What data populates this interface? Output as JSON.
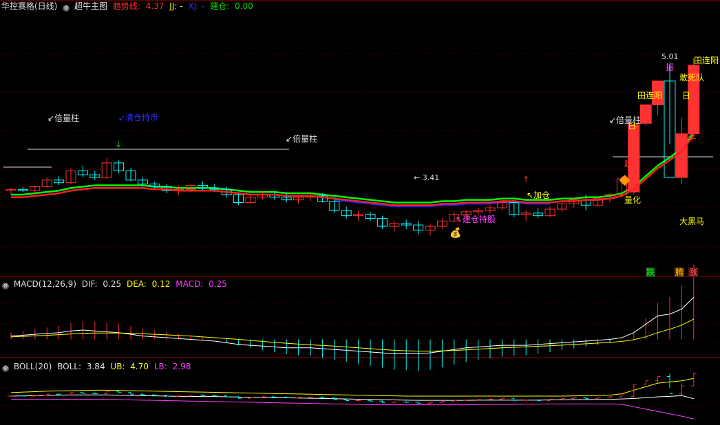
{
  "header_main": {
    "title": "华控赛格(日线)",
    "indicator": "超牛主图",
    "trend_label": "趋势线:",
    "trend_value": "4.37",
    "jj_label": "JJ: -",
    "xj_label": "XJ: -",
    "jc_label": "建仓:",
    "jc_value": "0.00"
  },
  "header_macd": {
    "name": "MACD(12,26,9)",
    "dif_label": "DIF:",
    "dif_value": "0.25",
    "dea_label": "DEA:",
    "dea_value": "0.12",
    "macd_label": "MACD:",
    "macd_value": "0.25"
  },
  "header_boll": {
    "name": "BOLL(20)",
    "boll_label": "BOLL:",
    "boll_value": "3.84",
    "ub_label": "UB:",
    "ub_value": "4.70",
    "lb_label": "LB:",
    "lb_value": "2.98"
  },
  "annotations": {
    "beiliangzhu_1": "↙倍量柱",
    "qingcang": "↙清仓持币",
    "beiliangzhu_2": "↙倍量柱",
    "low_price": "← 3.41",
    "jiancang": "↖建仓持股",
    "jiacang": "↖加仓",
    "beiliangzhu_3": "↙倍量柱",
    "chaoniu_1": "超牛",
    "chaoniu_2": "超牛",
    "lianglua": "量化",
    "dahei": "大黑马",
    "tianlianyang_1": "田连阳",
    "tianlianyang_2": "田连阳",
    "gansidui": "敢死队",
    "zhen": "振",
    "high_price": "5.01",
    "ri_1": "日",
    "ri_2": "日",
    "die": "跌",
    "zhang": "涨",
    "teng": "腾"
  },
  "colors": {
    "bg": "#000000",
    "grid": "#8b0000",
    "up": "#ff3232",
    "down": "#00ffff",
    "trend": "#ff2020",
    "green_line": "#00ff00",
    "blue_line": "#2020ff",
    "macd_dif": "#ffffff",
    "macd_dea": "#ffff00",
    "boll_mid": "#ffffff",
    "boll_ub": "#ffff00",
    "boll_lb": "#ff40ff"
  },
  "chart_data": {
    "type": "candlestick",
    "candles": [
      [
        3.95,
        3.97,
        3.92,
        3.96
      ],
      [
        3.96,
        3.98,
        3.94,
        3.95
      ],
      [
        3.95,
        3.99,
        3.93,
        3.98
      ],
      [
        3.98,
        4.05,
        3.97,
        4.03
      ],
      [
        4.03,
        4.06,
        3.99,
        4.01
      ],
      [
        4.01,
        4.12,
        4.0,
        4.1
      ],
      [
        4.1,
        4.14,
        4.05,
        4.07
      ],
      [
        4.07,
        4.1,
        4.03,
        4.05
      ],
      [
        4.05,
        4.2,
        4.04,
        4.16
      ],
      [
        4.16,
        4.18,
        4.08,
        4.1
      ],
      [
        4.1,
        4.12,
        4.02,
        4.03
      ],
      [
        4.03,
        4.05,
        3.98,
        4.0
      ],
      [
        4.0,
        4.02,
        3.96,
        3.98
      ],
      [
        3.98,
        4.0,
        3.93,
        3.95
      ],
      [
        3.95,
        3.99,
        3.92,
        3.96
      ],
      [
        3.96,
        4.0,
        3.94,
        3.99
      ],
      [
        3.99,
        4.02,
        3.95,
        3.97
      ],
      [
        3.97,
        4.0,
        3.94,
        3.96
      ],
      [
        3.96,
        3.98,
        3.9,
        3.92
      ],
      [
        3.92,
        3.94,
        3.84,
        3.86
      ],
      [
        3.86,
        3.92,
        3.85,
        3.9
      ],
      [
        3.9,
        3.95,
        3.88,
        3.92
      ],
      [
        3.92,
        3.94,
        3.88,
        3.9
      ],
      [
        3.9,
        3.93,
        3.86,
        3.88
      ],
      [
        3.88,
        3.92,
        3.85,
        3.9
      ],
      [
        3.9,
        3.93,
        3.87,
        3.91
      ],
      [
        3.91,
        3.93,
        3.86,
        3.87
      ],
      [
        3.87,
        3.9,
        3.78,
        3.8
      ],
      [
        3.8,
        3.83,
        3.74,
        3.76
      ],
      [
        3.76,
        3.8,
        3.72,
        3.77
      ],
      [
        3.77,
        3.79,
        3.72,
        3.74
      ],
      [
        3.74,
        3.76,
        3.66,
        3.68
      ],
      [
        3.68,
        3.72,
        3.64,
        3.7
      ],
      [
        3.7,
        3.73,
        3.66,
        3.69
      ],
      [
        3.69,
        3.72,
        3.62,
        3.65
      ],
      [
        3.65,
        3.7,
        3.61,
        3.68
      ],
      [
        3.68,
        3.74,
        3.66,
        3.72
      ],
      [
        3.72,
        3.79,
        3.71,
        3.77
      ],
      [
        3.77,
        3.8,
        3.74,
        3.79
      ],
      [
        3.79,
        3.82,
        3.76,
        3.8
      ],
      [
        3.8,
        3.84,
        3.78,
        3.82
      ],
      [
        3.82,
        3.88,
        3.8,
        3.86
      ],
      [
        3.86,
        3.88,
        3.75,
        3.77
      ],
      [
        3.77,
        3.8,
        3.72,
        3.78
      ],
      [
        3.78,
        3.82,
        3.74,
        3.76
      ],
      [
        3.76,
        3.83,
        3.75,
        3.81
      ],
      [
        3.81,
        3.87,
        3.79,
        3.85
      ],
      [
        3.85,
        3.9,
        3.82,
        3.88
      ],
      [
        3.88,
        3.92,
        3.8,
        3.84
      ],
      [
        3.84,
        3.9,
        3.83,
        3.89
      ],
      [
        3.89,
        3.93,
        3.86,
        3.92
      ],
      [
        3.92,
        4.06,
        3.9,
        4.04
      ],
      [
        3.94,
        4.46,
        3.92,
        4.45
      ],
      [
        4.46,
        4.6,
        4.44,
        4.6
      ],
      [
        4.6,
        4.78,
        4.52,
        4.78
      ],
      [
        4.78,
        4.9,
        4.3,
        4.05
      ],
      [
        4.05,
        4.5,
        4.0,
        4.38
      ],
      [
        4.38,
        4.95,
        4.36,
        4.9
      ]
    ],
    "trend": [
      3.9,
      3.9,
      3.91,
      3.92,
      3.93,
      3.95,
      3.96,
      3.97,
      3.97,
      3.97,
      3.97,
      3.97,
      3.96,
      3.96,
      3.95,
      3.95,
      3.95,
      3.95,
      3.94,
      3.93,
      3.92,
      3.92,
      3.92,
      3.91,
      3.91,
      3.91,
      3.9,
      3.89,
      3.88,
      3.87,
      3.86,
      3.85,
      3.84,
      3.84,
      3.84,
      3.84,
      3.85,
      3.85,
      3.86,
      3.86,
      3.86,
      3.87,
      3.87,
      3.86,
      3.86,
      3.86,
      3.87,
      3.87,
      3.88,
      3.88,
      3.89,
      3.91,
      3.96,
      4.04,
      4.12,
      4.18,
      4.25,
      4.37
    ],
    "price_range": [
      3.3,
      5.3
    ],
    "macd": {
      "dif": [
        0.02,
        0.025,
        0.03,
        0.035,
        0.04,
        0.05,
        0.055,
        0.05,
        0.045,
        0.04,
        0.03,
        0.02,
        0.015,
        0.01,
        0.005,
        0,
        -0.005,
        -0.01,
        -0.02,
        -0.03,
        -0.035,
        -0.04,
        -0.045,
        -0.05,
        -0.05,
        -0.05,
        -0.055,
        -0.06,
        -0.065,
        -0.07,
        -0.075,
        -0.08,
        -0.085,
        -0.085,
        -0.085,
        -0.08,
        -0.07,
        -0.06,
        -0.05,
        -0.045,
        -0.04,
        -0.035,
        -0.035,
        -0.035,
        -0.03,
        -0.025,
        -0.02,
        -0.015,
        -0.01,
        -0.005,
        0,
        0.01,
        0.04,
        0.09,
        0.14,
        0.15,
        0.18,
        0.25
      ],
      "dea": [
        0.015,
        0.018,
        0.021,
        0.024,
        0.028,
        0.032,
        0.036,
        0.038,
        0.038,
        0.038,
        0.036,
        0.033,
        0.03,
        0.027,
        0.023,
        0.02,
        0.015,
        0.01,
        0.005,
        0,
        -0.006,
        -0.012,
        -0.018,
        -0.023,
        -0.028,
        -0.032,
        -0.036,
        -0.04,
        -0.045,
        -0.05,
        -0.055,
        -0.06,
        -0.065,
        -0.068,
        -0.07,
        -0.07,
        -0.068,
        -0.066,
        -0.062,
        -0.058,
        -0.054,
        -0.05,
        -0.047,
        -0.044,
        -0.041,
        -0.038,
        -0.034,
        -0.03,
        -0.026,
        -0.022,
        -0.018,
        -0.012,
        -0.002,
        0.015,
        0.04,
        0.06,
        0.085,
        0.12
      ],
      "range": [
        -0.1,
        0.3
      ]
    },
    "boll": {
      "mid": [
        3.95,
        3.96,
        3.97,
        3.98,
        3.99,
        4.0,
        4.0,
        4.0,
        4.0,
        3.99,
        3.98,
        3.97,
        3.96,
        3.95,
        3.94,
        3.94,
        3.93,
        3.93,
        3.92,
        3.91,
        3.9,
        3.89,
        3.88,
        3.88,
        3.87,
        3.86,
        3.85,
        3.84,
        3.83,
        3.82,
        3.81,
        3.8,
        3.79,
        3.78,
        3.77,
        3.77,
        3.77,
        3.77,
        3.77,
        3.78,
        3.78,
        3.78,
        3.78,
        3.78,
        3.78,
        3.79,
        3.79,
        3.8,
        3.8,
        3.81,
        3.81,
        3.83,
        3.85,
        3.88,
        3.92,
        3.94,
        3.97,
        3.84
      ],
      "ub": [
        4.1,
        4.12,
        4.14,
        4.16,
        4.17,
        4.18,
        4.19,
        4.2,
        4.2,
        4.19,
        4.18,
        4.17,
        4.16,
        4.15,
        4.14,
        4.13,
        4.12,
        4.11,
        4.1,
        4.09,
        4.08,
        4.07,
        4.06,
        4.05,
        4.04,
        4.03,
        4.02,
        4.01,
        4.0,
        3.99,
        3.98,
        3.97,
        3.96,
        3.95,
        3.95,
        3.95,
        3.95,
        3.95,
        3.95,
        3.95,
        3.95,
        3.95,
        3.95,
        3.95,
        3.95,
        3.95,
        3.95,
        3.96,
        3.97,
        3.98,
        3.99,
        4.05,
        4.2,
        4.35,
        4.5,
        4.55,
        4.6,
        4.7
      ],
      "lb": [
        3.82,
        3.82,
        3.82,
        3.82,
        3.82,
        3.82,
        3.82,
        3.82,
        3.81,
        3.8,
        3.79,
        3.78,
        3.77,
        3.76,
        3.75,
        3.74,
        3.73,
        3.72,
        3.71,
        3.7,
        3.69,
        3.68,
        3.67,
        3.66,
        3.65,
        3.64,
        3.63,
        3.62,
        3.61,
        3.6,
        3.59,
        3.59,
        3.58,
        3.58,
        3.58,
        3.58,
        3.58,
        3.58,
        3.58,
        3.59,
        3.6,
        3.6,
        3.6,
        3.61,
        3.61,
        3.62,
        3.62,
        3.62,
        3.62,
        3.62,
        3.62,
        3.6,
        3.5,
        3.4,
        3.3,
        3.2,
        3.1,
        2.98
      ],
      "range": [
        2.9,
        5.0
      ]
    }
  }
}
